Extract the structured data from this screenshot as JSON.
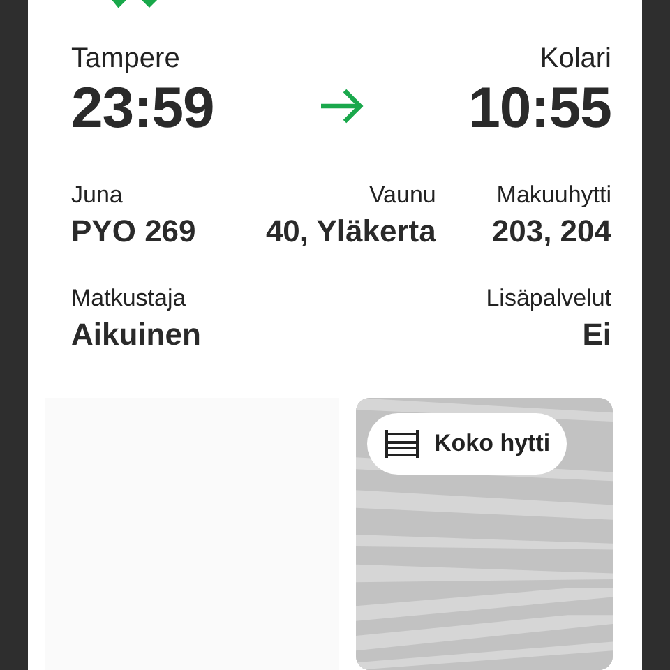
{
  "route": {
    "from": "Tampere",
    "to": "Kolari",
    "departure": "23:59",
    "arrival": "10:55"
  },
  "details": [
    {
      "label": "Juna",
      "value": "PYO 269"
    },
    {
      "label": "Vaunu",
      "value": "40, Yläkerta"
    },
    {
      "label": "Makuuhytti",
      "value": "203, 204"
    }
  ],
  "passenger": [
    {
      "label": "Matkustaja",
      "value": "Aikuinen"
    },
    {
      "label": "Lisäpalvelut",
      "value": "Ei"
    }
  ],
  "cabin": {
    "badge": "Koko hytti"
  }
}
